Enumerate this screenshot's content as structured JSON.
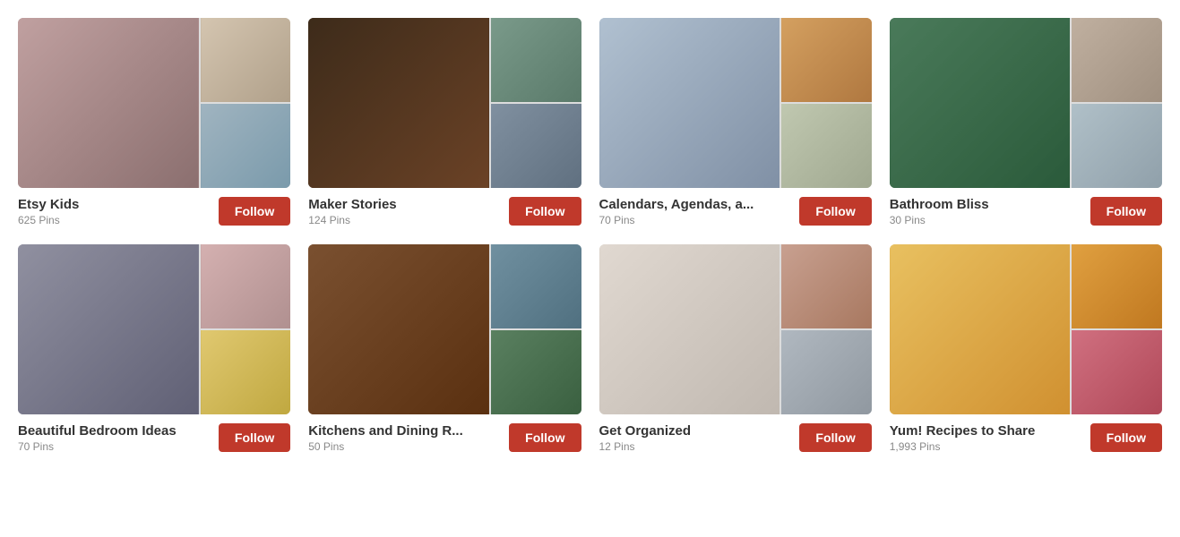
{
  "boards": [
    {
      "id": "etsy-kids",
      "title": "Etsy Kids",
      "pins": "625 Pins",
      "follow_label": "Follow",
      "main_class": "board-etsy-main",
      "thumb1_class": "board-etsy-t1",
      "thumb2_class": "board-etsy-t2"
    },
    {
      "id": "maker-stories",
      "title": "Maker Stories",
      "pins": "124 Pins",
      "follow_label": "Follow",
      "main_class": "board-maker-main",
      "thumb1_class": "board-maker-t1",
      "thumb2_class": "board-maker-t2"
    },
    {
      "id": "calendars-agendas",
      "title": "Calendars, Agendas, a...",
      "pins": "70 Pins",
      "follow_label": "Follow",
      "main_class": "board-cal-main",
      "thumb1_class": "board-cal-t1",
      "thumb2_class": "board-cal-t2"
    },
    {
      "id": "bathroom-bliss",
      "title": "Bathroom Bliss",
      "pins": "30 Pins",
      "follow_label": "Follow",
      "main_class": "board-bath-main",
      "thumb1_class": "board-bath-t1",
      "thumb2_class": "board-bath-t2"
    },
    {
      "id": "beautiful-bedroom",
      "title": "Beautiful Bedroom Ideas",
      "pins": "70 Pins",
      "follow_label": "Follow",
      "main_class": "board-bed-main",
      "thumb1_class": "board-bed-t1",
      "thumb2_class": "board-bed-t2"
    },
    {
      "id": "kitchens-dining",
      "title": "Kitchens and Dining R...",
      "pins": "50 Pins",
      "follow_label": "Follow",
      "main_class": "board-kit-main",
      "thumb1_class": "board-kit-t1",
      "thumb2_class": "board-kit-t2"
    },
    {
      "id": "get-organized",
      "title": "Get Organized",
      "pins": "12 Pins",
      "follow_label": "Follow",
      "main_class": "board-org-main",
      "thumb1_class": "board-org-t1",
      "thumb2_class": "board-org-t2"
    },
    {
      "id": "yum-recipes",
      "title": "Yum! Recipes to Share",
      "pins": "1,993 Pins",
      "follow_label": "Follow",
      "main_class": "board-yum-main",
      "thumb1_class": "board-yum-t1",
      "thumb2_class": "board-yum-t2"
    }
  ]
}
